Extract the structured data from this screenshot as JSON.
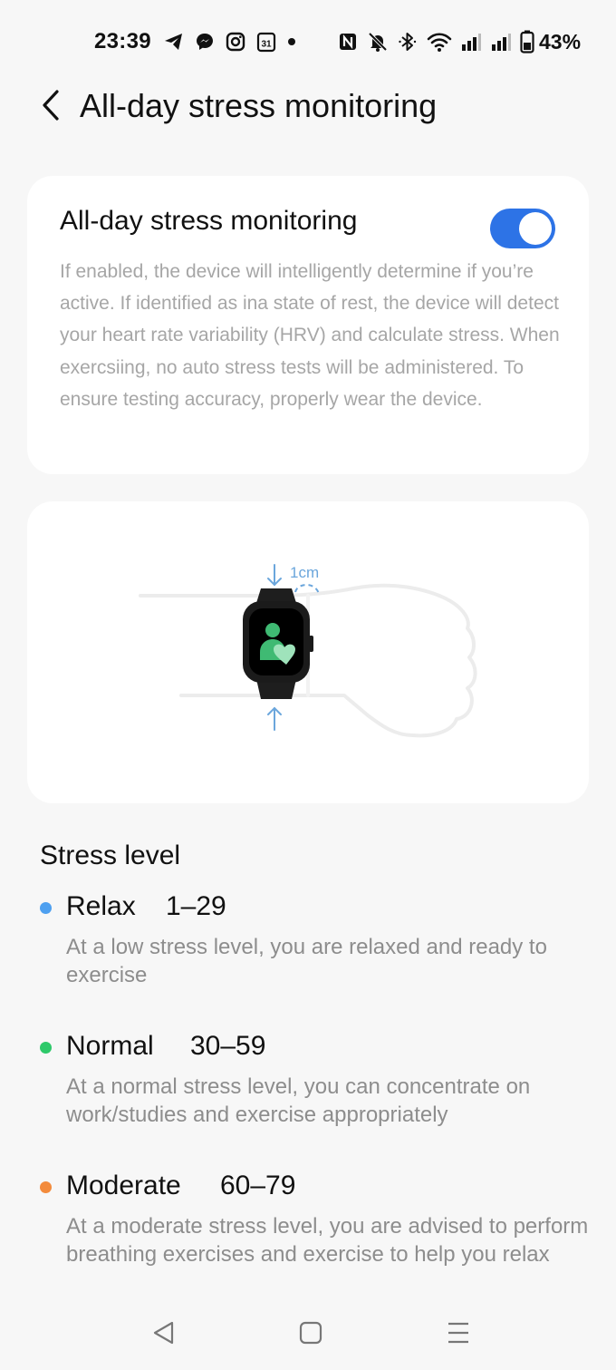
{
  "status_bar": {
    "time": "23:39",
    "battery_percent": "43%",
    "left_icons": [
      "telegram-icon",
      "messenger-icon",
      "instagram-icon",
      "calendar-icon",
      "dot-icon"
    ],
    "right_icons": [
      "nfc-icon",
      "mute-icon",
      "bluetooth-icon",
      "wifi-icon",
      "signal-icon",
      "signal-icon",
      "battery-icon"
    ],
    "calendar_day": "31"
  },
  "header": {
    "title": "All-day stress monitoring"
  },
  "toggle_card": {
    "title": "All-day stress monitoring",
    "enabled": true,
    "accent_color": "#2d73e6",
    "description": "If enabled, the device will intelligently determine if you’re active. If identified as ina  state of rest, the device will detect your heart rate variability (HRV) and calculate stress. When exercsiing, no auto stress tests will be administered. To ensure testing accuracy, properly wear the device."
  },
  "illustration": {
    "distance_label": "1cm"
  },
  "stress_levels": {
    "title": "Stress level",
    "items": [
      {
        "name": "Relax",
        "range": "1–29",
        "color": "#4ea0f0",
        "description": "At a low stress level, you are relaxed and ready to exercise"
      },
      {
        "name": "Normal",
        "range": "30–59",
        "color": "#2ec96a",
        "description": "At a normal stress level, you can concentrate on work/studies and exercise appropriately"
      },
      {
        "name": "Moderate",
        "range": "60–79",
        "color": "#f38b3c",
        "description": "At a moderate stress level, you are advised to perform breathing exercises and exercise to help you relax"
      }
    ]
  },
  "nav_bar": {
    "buttons": [
      "back-nav-icon",
      "home-nav-icon",
      "recents-nav-icon"
    ]
  }
}
